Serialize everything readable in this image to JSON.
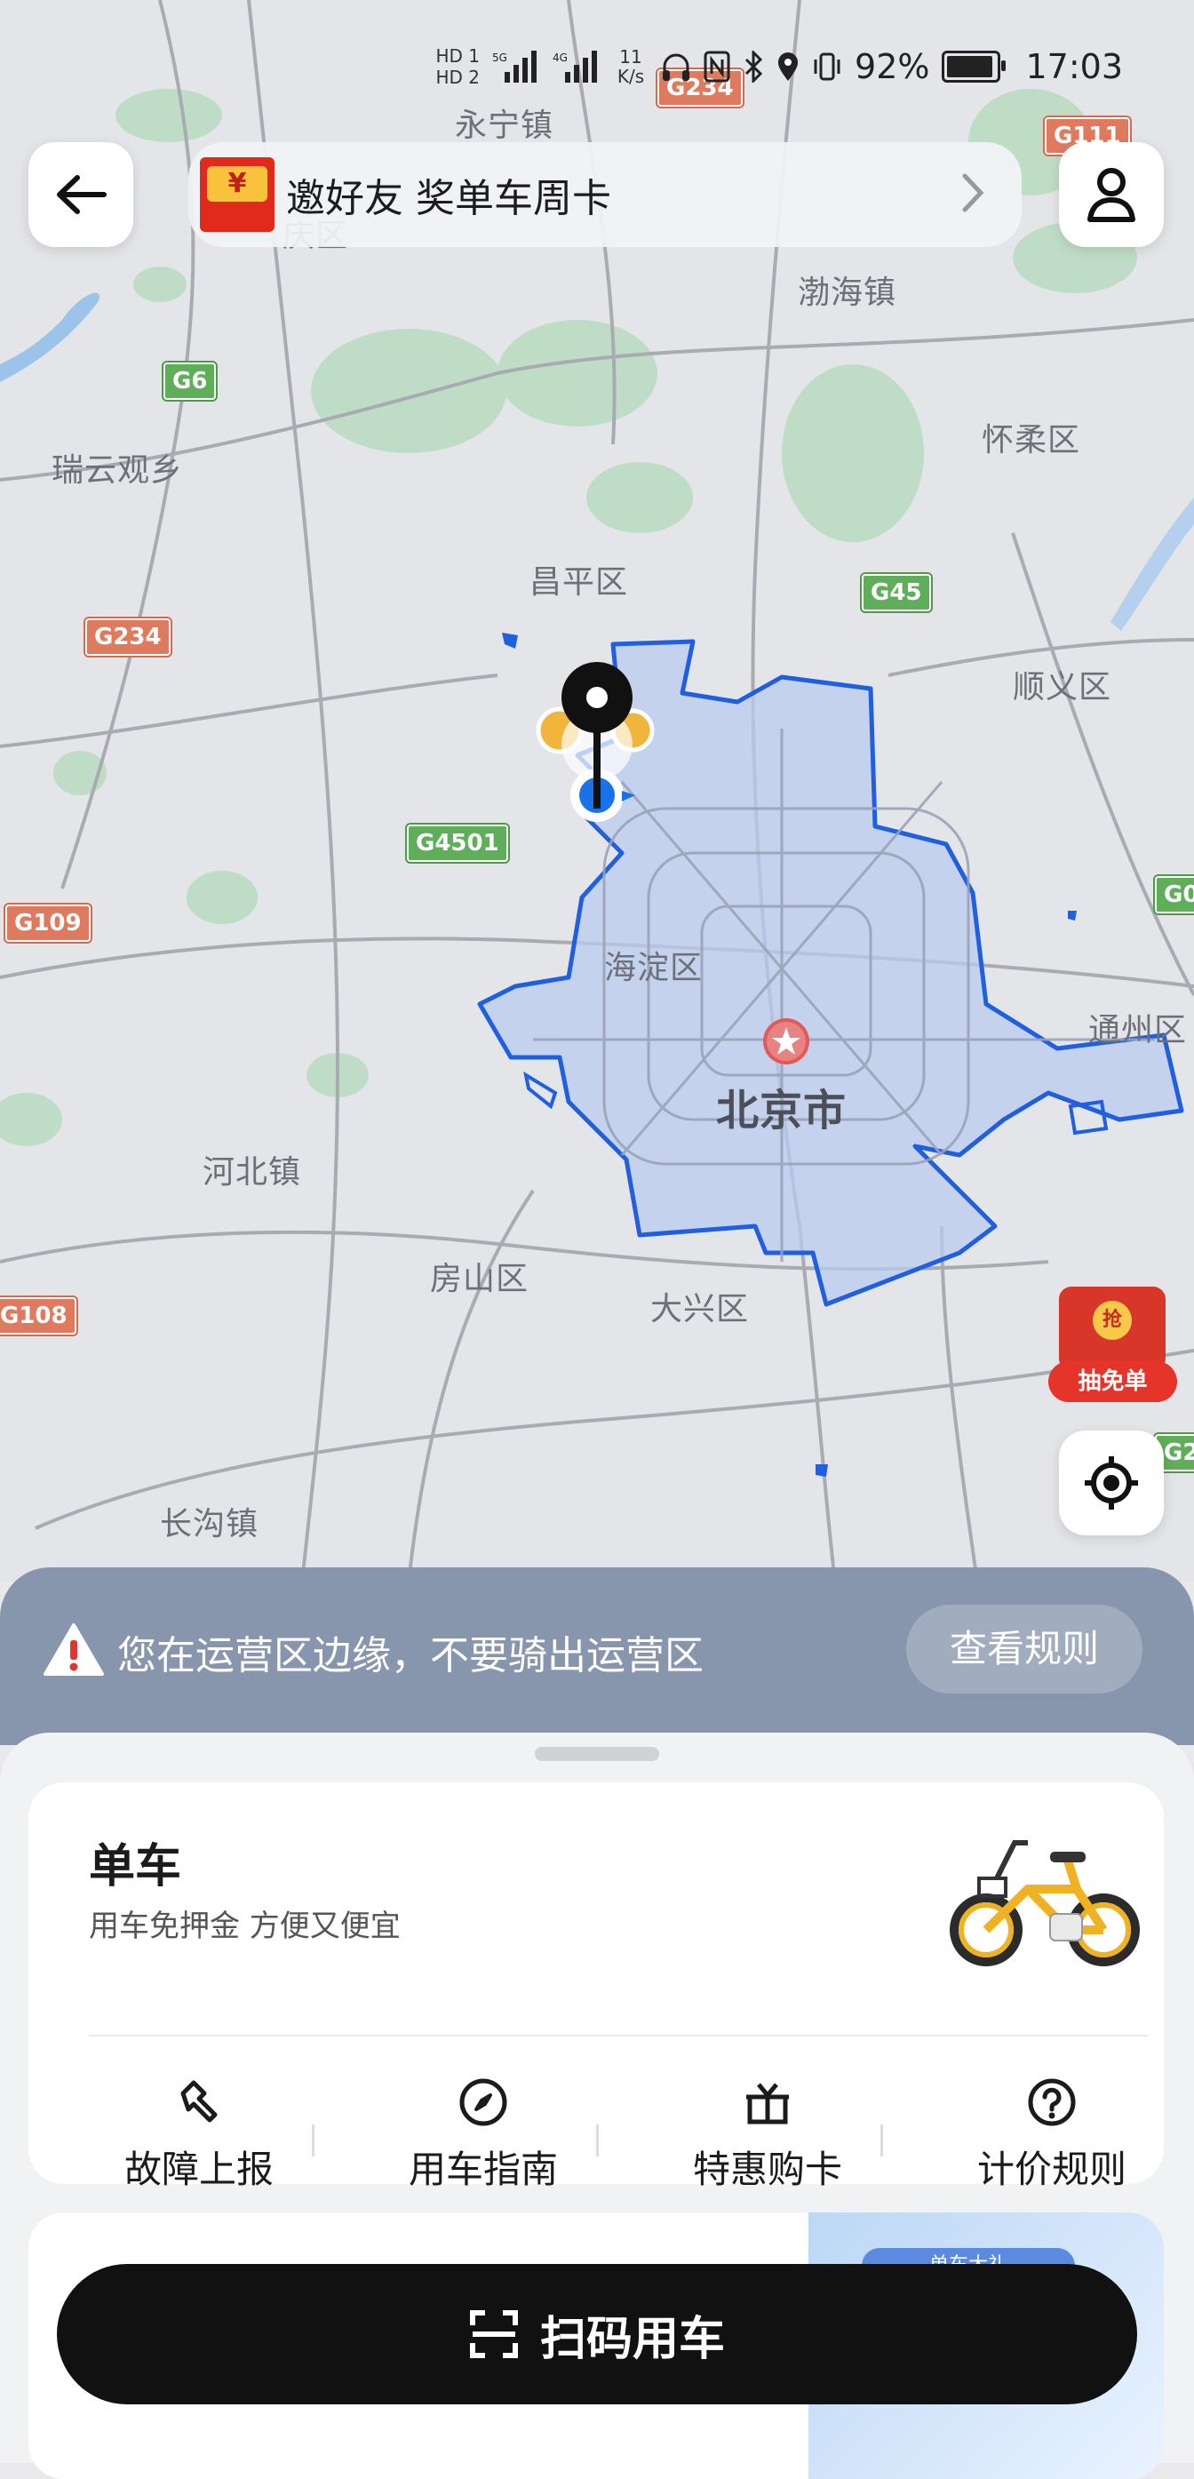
{
  "status_bar": {
    "network_small": "11\nK/s",
    "battery_percent": "92%",
    "time": "17:03",
    "sim1_tag": "HD 1",
    "sim2_tag": "HD 2",
    "sig1_tag": "5G",
    "sig2_tag": "4G"
  },
  "top": {
    "banner_text": "邀好友 奖单车周卡",
    "redpacket_symbol": "¥"
  },
  "map": {
    "places": [
      {
        "name": "永宁镇"
      },
      {
        "name": "渤海镇"
      },
      {
        "name": "瑞云观乡"
      },
      {
        "name": "怀柔区"
      },
      {
        "name": "昌平区"
      },
      {
        "name": "顺义区"
      },
      {
        "name": "海淀区"
      },
      {
        "name": "北京市"
      },
      {
        "name": "通州区"
      },
      {
        "name": "河北镇"
      },
      {
        "name": "房山区"
      },
      {
        "name": "大兴区"
      },
      {
        "name": "长沟镇"
      }
    ],
    "road_shields": [
      {
        "code": "G234",
        "color": "red"
      },
      {
        "code": "G111",
        "color": "red"
      },
      {
        "code": "G6",
        "color": "green"
      },
      {
        "code": "G234",
        "color": "red"
      },
      {
        "code": "G45",
        "color": "green"
      },
      {
        "code": "G4501",
        "color": "green"
      },
      {
        "code": "G109",
        "color": "red"
      },
      {
        "code": "G0",
        "color": "green"
      },
      {
        "code": "G108",
        "color": "red"
      },
      {
        "code": "G2",
        "color": "green"
      }
    ],
    "partial_label": "庆区"
  },
  "promo": {
    "label": "抽免单",
    "chip": "抢"
  },
  "notice": {
    "text": "您在运营区边缘，不要骑出运营区",
    "button": "查看规则"
  },
  "bike_card": {
    "title": "单车",
    "subtitle": "用车免押金 方便又便宜",
    "actions": [
      {
        "label": "故障上报",
        "icon": "wrench-icon"
      },
      {
        "label": "用车指南",
        "icon": "compass-icon"
      },
      {
        "label": "特惠购卡",
        "icon": "gift-icon"
      },
      {
        "label": "计价规则",
        "icon": "question-icon"
      }
    ]
  },
  "promo_card": {
    "chip": "单车大礼"
  },
  "scan_button": {
    "label": "扫码用车"
  },
  "colors": {
    "zone_fill": "#b9cbef",
    "zone_border": "#1f5fe0",
    "notice_bg": "#8796ad",
    "scan_bg": "#111111"
  }
}
